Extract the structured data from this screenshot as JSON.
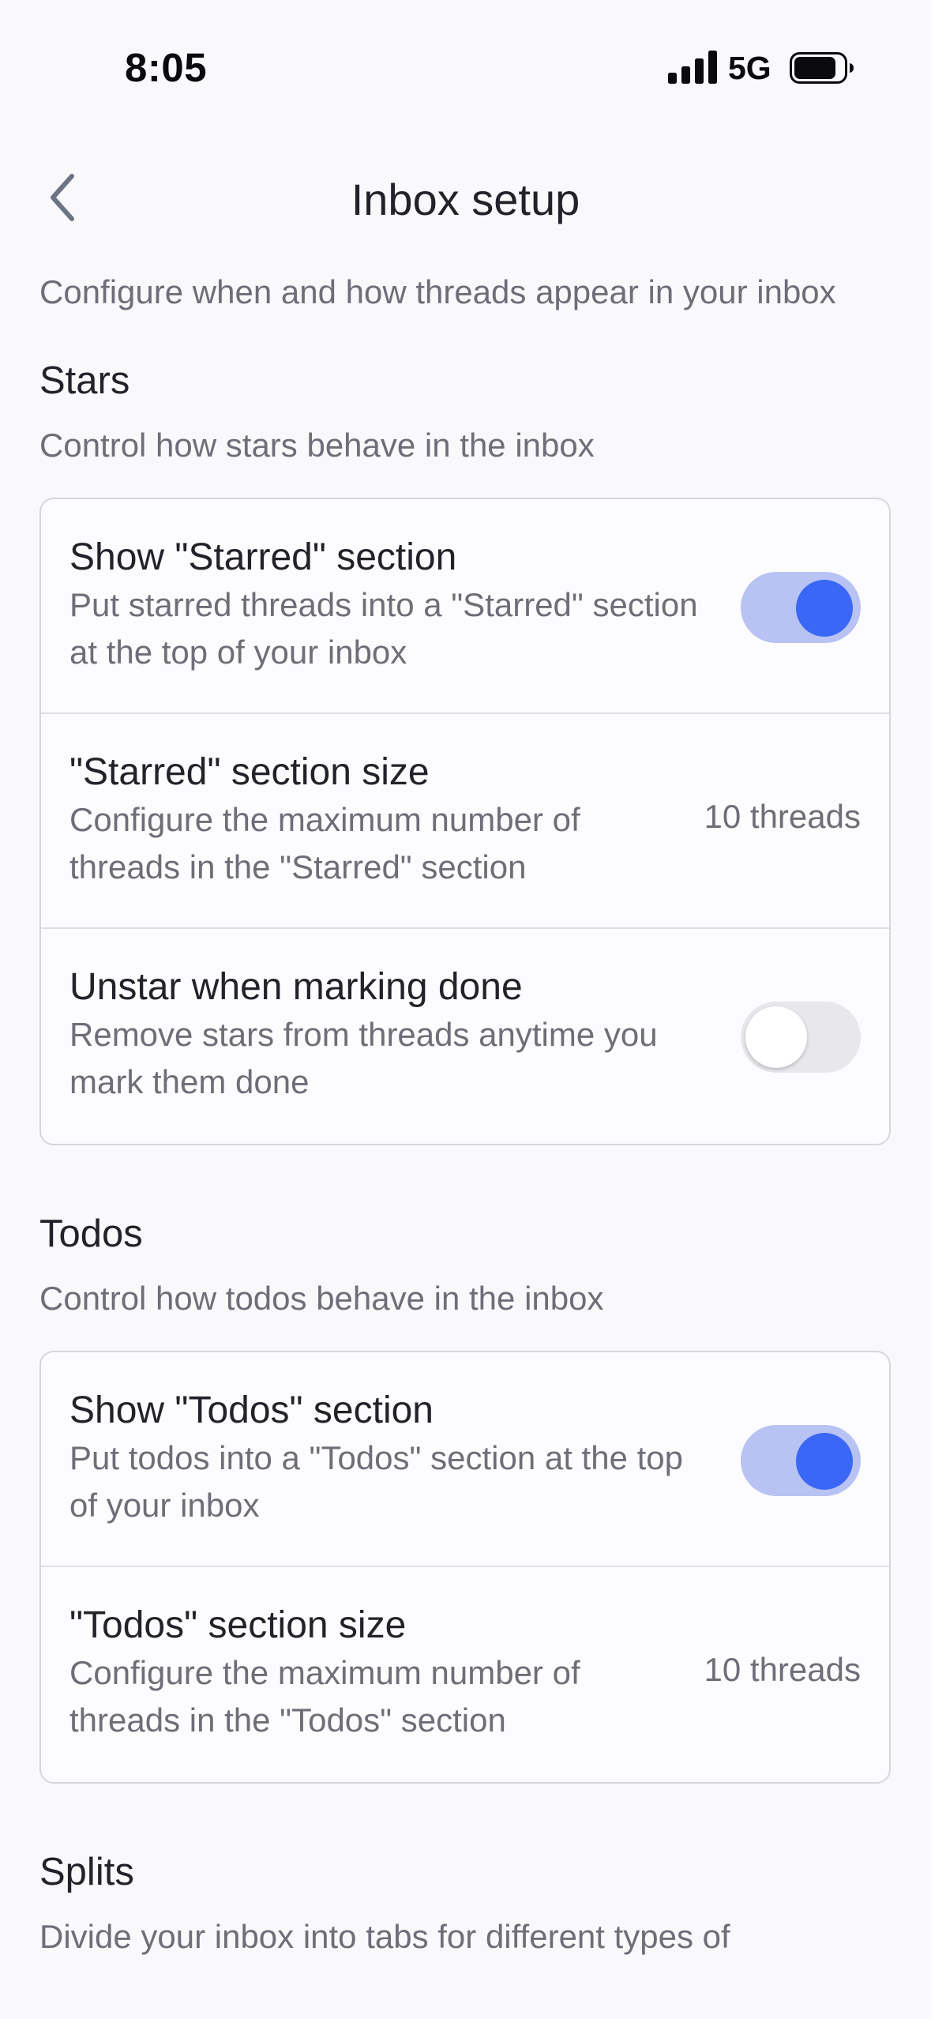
{
  "status_bar": {
    "time": "8:05",
    "network": "5G",
    "signal_icon": "cellular-signal-icon",
    "battery_icon": "battery-icon"
  },
  "header": {
    "title": "Inbox setup",
    "back_icon": "chevron-left-icon"
  },
  "intro": "Configure when and how threads appear in your inbox",
  "sections": {
    "stars": {
      "heading": "Stars",
      "description": "Control how stars behave in the inbox",
      "rows": [
        {
          "title": "Show \"Starred\" section",
          "subtitle": "Put starred threads into a \"Starred\" section at the top of your inbox",
          "toggle": true
        },
        {
          "title": "\"Starred\" section size",
          "subtitle": "Configure the maximum number of threads in the \"Starred\" section",
          "value": "10 threads"
        },
        {
          "title": "Unstar when marking done",
          "subtitle": "Remove stars from threads anytime you mark them done",
          "toggle": false
        }
      ]
    },
    "todos": {
      "heading": "Todos",
      "description": "Control how todos behave in the inbox",
      "rows": [
        {
          "title": "Show \"Todos\" section",
          "subtitle": "Put todos into a \"Todos\" section at the top of your inbox",
          "toggle": true
        },
        {
          "title": "\"Todos\" section size",
          "subtitle": "Configure the maximum number of threads in the \"Todos\" section",
          "value": "10 threads"
        }
      ]
    },
    "splits": {
      "heading": "Splits",
      "description": "Divide your inbox into tabs for different types of"
    }
  },
  "colors": {
    "accent": "#3a67f5",
    "toggle_track_on": "#b8c3f3",
    "toggle_track_off": "#e8e8ec",
    "background": "#f9f9fc"
  }
}
